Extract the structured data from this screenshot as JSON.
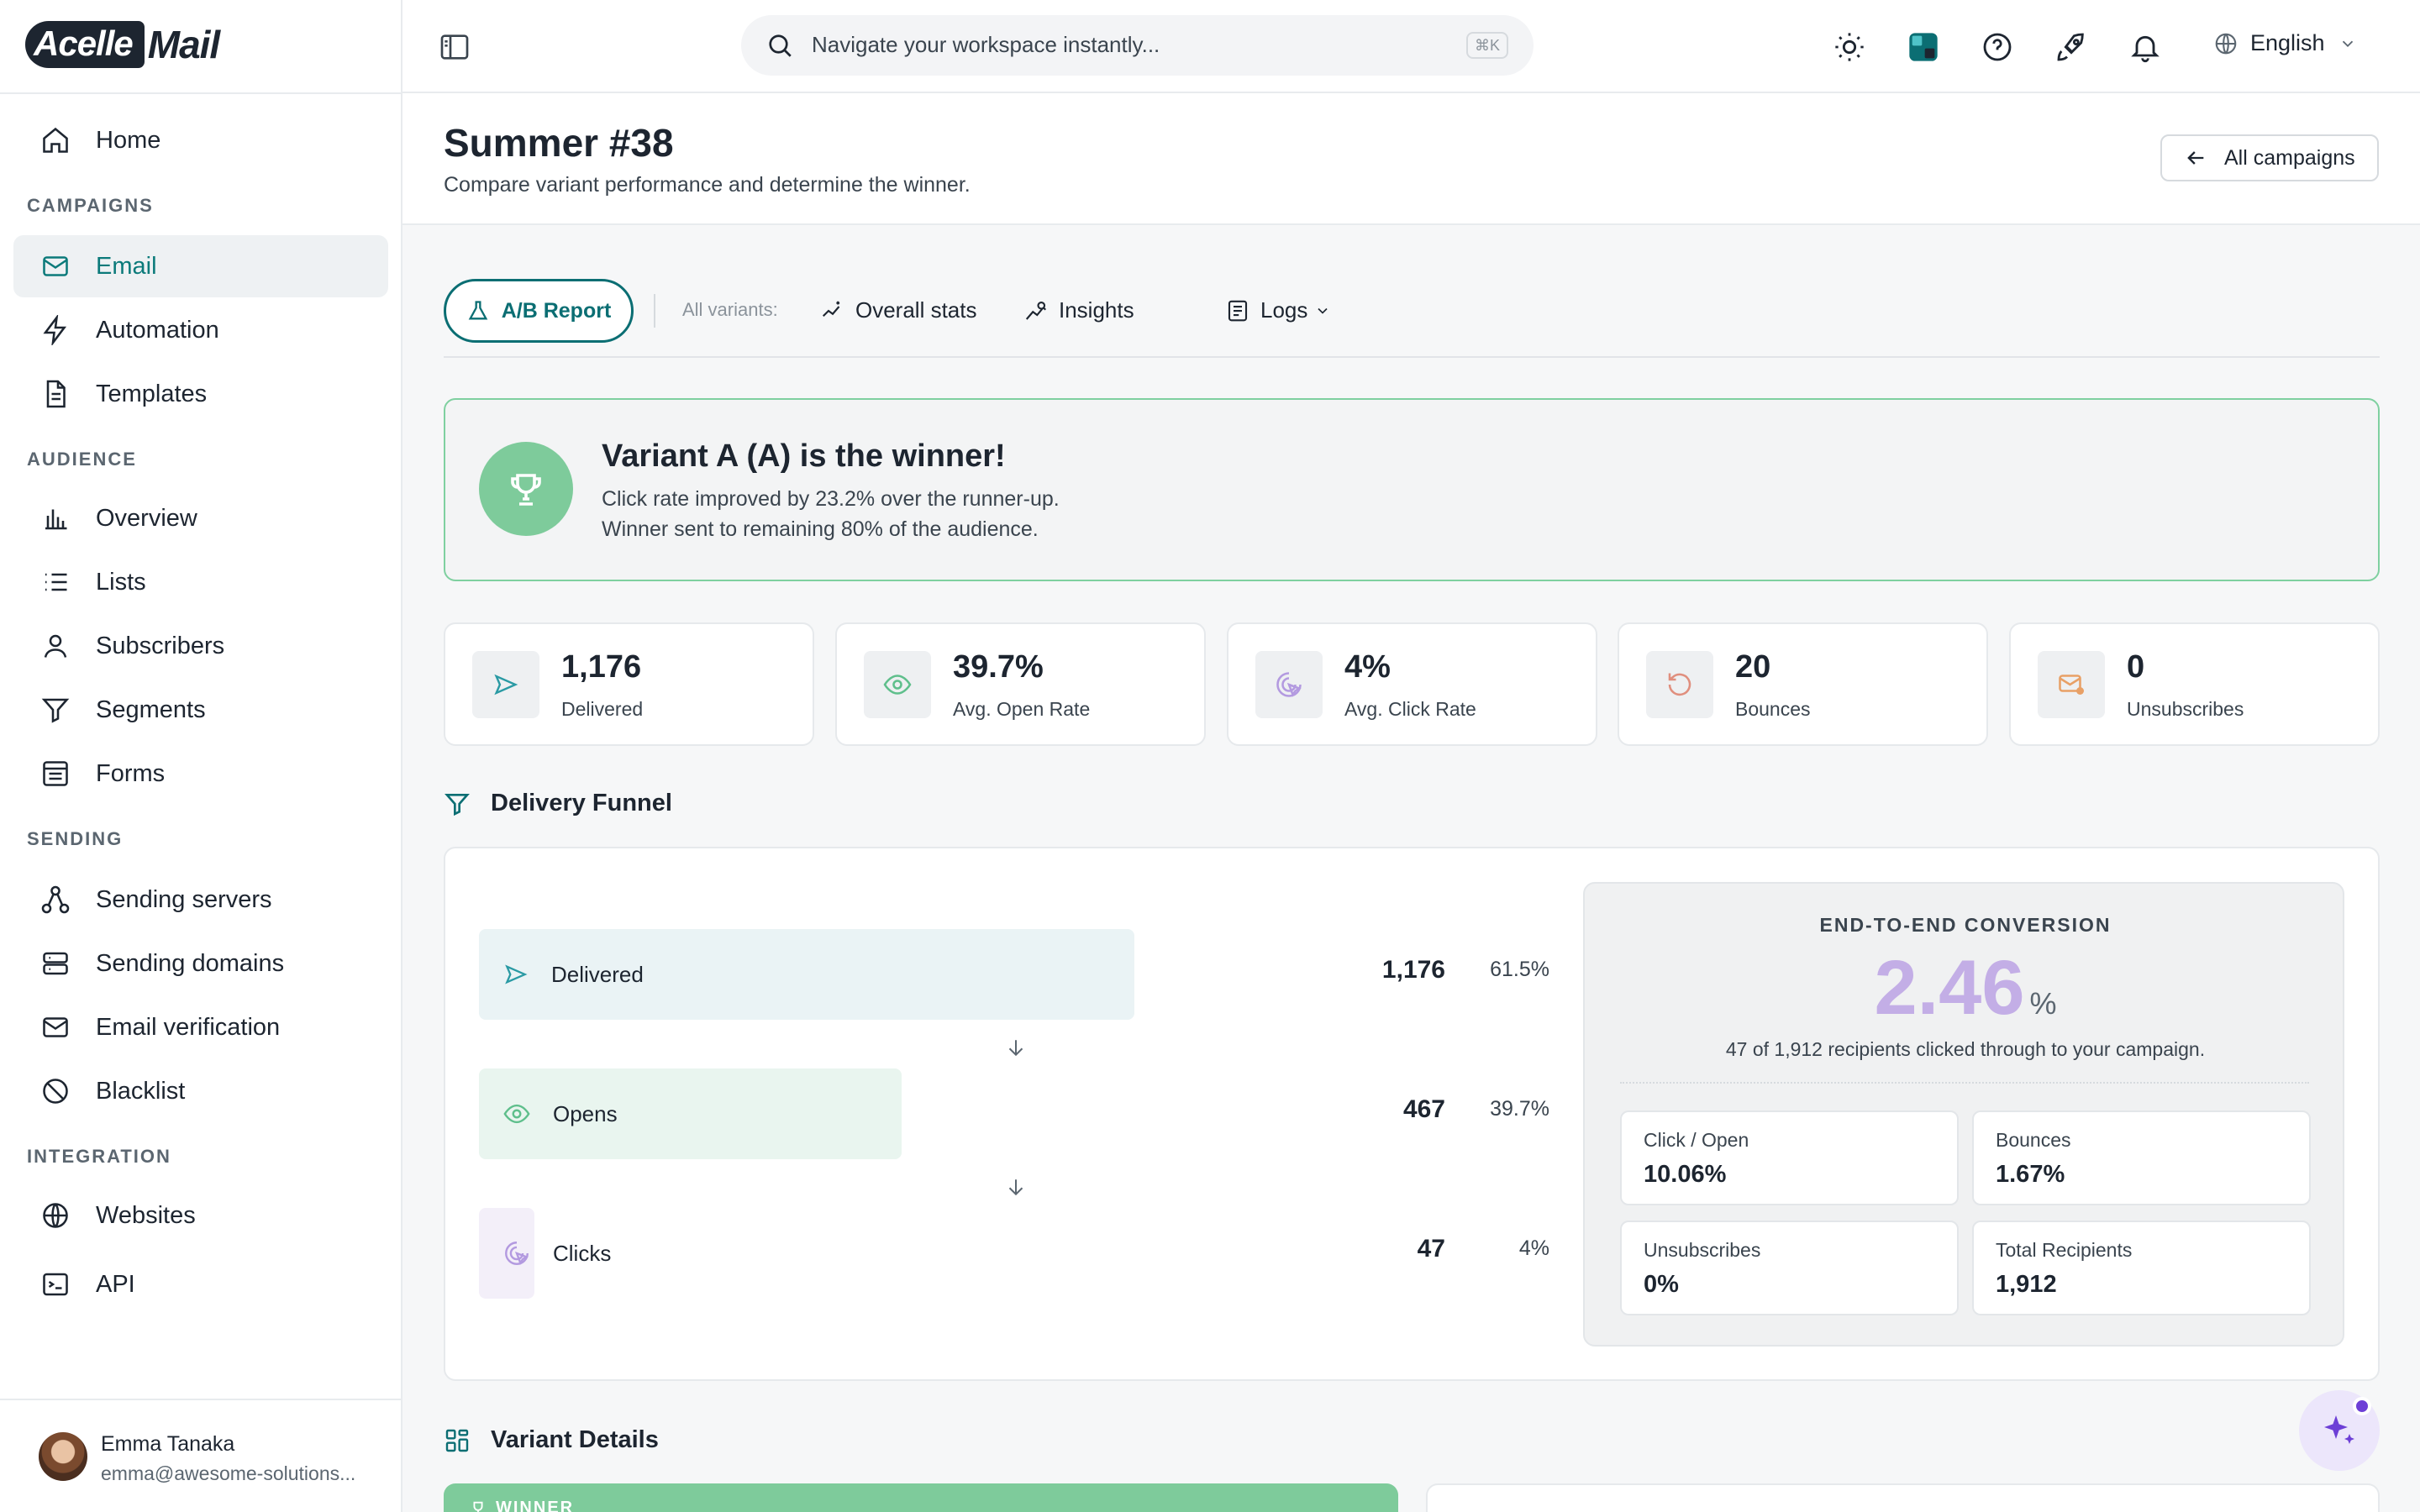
{
  "app": {
    "logo_box": "Acelle",
    "logo_word": "Mail"
  },
  "sidebar": {
    "home": "Home",
    "sections": {
      "campaigns": "CAMPAIGNS",
      "audience": "AUDIENCE",
      "sending": "SENDING",
      "integration": "INTEGRATION"
    },
    "items": {
      "email": "Email",
      "automation": "Automation",
      "templates": "Templates",
      "overview": "Overview",
      "lists": "Lists",
      "subscribers": "Subscribers",
      "segments": "Segments",
      "forms": "Forms",
      "sending_servers": "Sending servers",
      "sending_domains": "Sending domains",
      "email_verification": "Email verification",
      "blacklist": "Blacklist",
      "websites": "Websites",
      "api": "API"
    },
    "active_item": "Email",
    "user": {
      "name": "Emma Tanaka",
      "email": "emma@awesome-solutions..."
    }
  },
  "topbar": {
    "search_placeholder": "Navigate your workspace instantly...",
    "search_shortcut": "⌘K",
    "language": "English"
  },
  "page": {
    "title": "Summer #38",
    "subtitle": "Compare variant performance and determine the winner.",
    "back_button": "All campaigns"
  },
  "tabs": {
    "ab_report": "A/B Report",
    "all_variants_label": "All variants:",
    "overall_stats": "Overall stats",
    "insights": "Insights",
    "logs": "Logs"
  },
  "winner": {
    "title": "Variant A (A) is the winner!",
    "line1": "Click rate improved by 23.2% over the runner-up.",
    "line2": "Winner sent to remaining 80% of the audience."
  },
  "stats": [
    {
      "value": "1,176",
      "label": "Delivered",
      "icon": "send-icon"
    },
    {
      "value": "39.7%",
      "label": "Avg. Open Rate",
      "icon": "eye-icon"
    },
    {
      "value": "4%",
      "label": "Avg. Click Rate",
      "icon": "click-icon"
    },
    {
      "value": "20",
      "label": "Bounces",
      "icon": "bounce-icon"
    },
    {
      "value": "0",
      "label": "Unsubscribes",
      "icon": "unsubscribe-icon"
    }
  ],
  "funnel": {
    "title": "Delivery Funnel",
    "rows": [
      {
        "label": "Delivered",
        "count": "1,176",
        "pct": "61.5%",
        "fill": 0.615
      },
      {
        "label": "Opens",
        "count": "467",
        "pct": "39.7%",
        "fill": 0.397
      },
      {
        "label": "Clicks",
        "count": "47",
        "pct": "4%",
        "fill": 0.04
      }
    ],
    "conversion": {
      "title": "END-TO-END CONVERSION",
      "value": "2.46",
      "unit": "%",
      "description": "47 of 1,912 recipients clicked through to your campaign.",
      "metrics": [
        {
          "label": "Click / Open",
          "value": "10.06%"
        },
        {
          "label": "Bounces",
          "value": "1.67%"
        },
        {
          "label": "Unsubscribes",
          "value": "0%"
        },
        {
          "label": "Total Recipients",
          "value": "1,912"
        }
      ]
    }
  },
  "variants": {
    "title": "Variant Details",
    "winner_badge": "WINNER"
  },
  "colors": {
    "accent": "#0b6e73",
    "winner_green": "#7ecb9b",
    "conversion_purple": "#c3aee6",
    "delivered_bar": "#eaf3f5",
    "opens_bar": "#e9f5ef",
    "clicks_bar": "#f3eff9"
  }
}
